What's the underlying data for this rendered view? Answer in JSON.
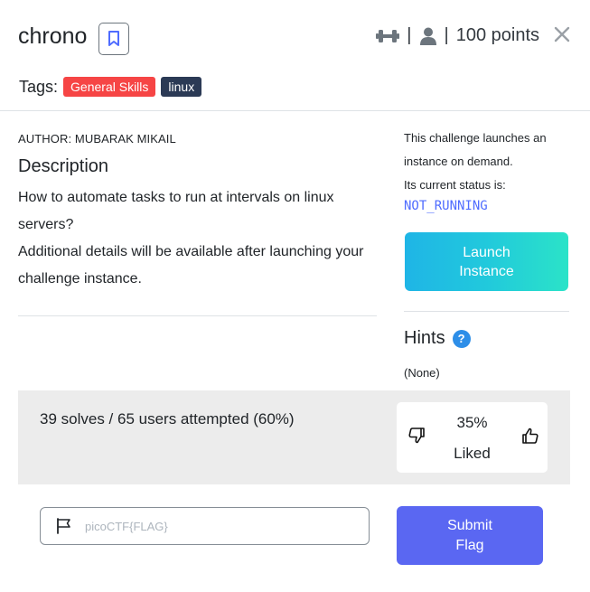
{
  "challenge": {
    "title": "chrono",
    "points": "100 points",
    "separator": "|"
  },
  "tags": {
    "label": "Tags:",
    "items": [
      {
        "name": "General Skills",
        "color": "#f64545"
      },
      {
        "name": "linux",
        "color": "#2b3a55"
      }
    ]
  },
  "description": {
    "author": "AUTHOR: MUBARAK MIKAIL",
    "heading": "Description",
    "line1": "How to automate tasks to run at intervals on linux servers?",
    "line2": "Additional details will be available after launching your challenge instance."
  },
  "instance": {
    "text1": "This challenge launches an instance on demand.",
    "text2": "Its current status is:",
    "status": "NOT_RUNNING",
    "launch_label_1": "Launch",
    "launch_label_2": "Instance"
  },
  "hints": {
    "heading": "Hints",
    "help_glyph": "?",
    "value": "(None)"
  },
  "stats": {
    "solves_text": "39 solves / 65 users attempted (60%)",
    "liked_pct": "35%",
    "liked_label": "Liked"
  },
  "flag": {
    "placeholder": "picoCTF{FLAG}",
    "submit_1": "Submit",
    "submit_2": "Flag"
  },
  "colors": {
    "accent": "#5a67f2",
    "status": "#4f6cff",
    "help": "#2d8ee8"
  },
  "icons": [
    "bookmark-icon",
    "dumbbell-icon",
    "user-icon",
    "close-icon",
    "help-icon",
    "thumbs-down-icon",
    "thumbs-up-icon",
    "flag-icon"
  ]
}
